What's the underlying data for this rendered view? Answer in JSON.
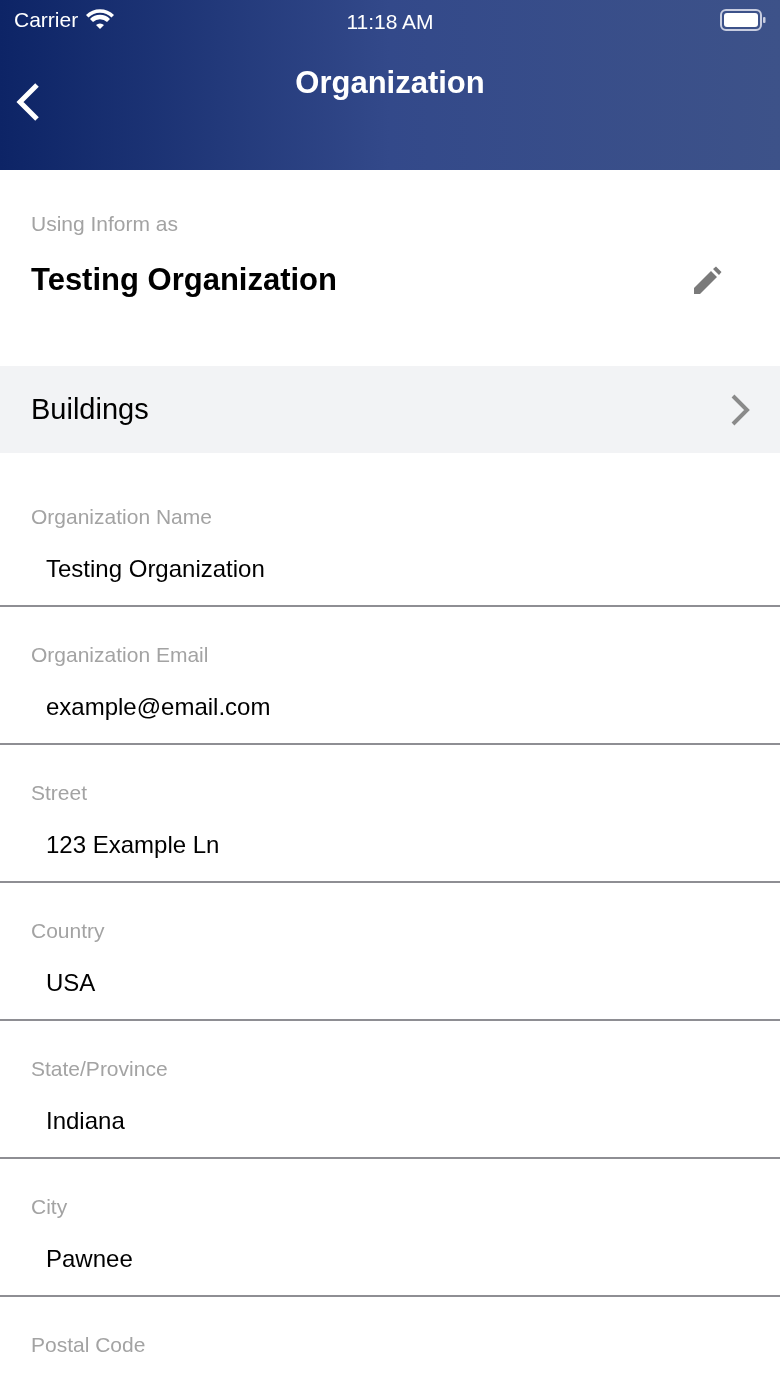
{
  "status_bar": {
    "carrier": "Carrier",
    "time": "11:18 AM"
  },
  "nav": {
    "title": "Organization"
  },
  "account": {
    "caption": "Using Inform as",
    "name": "Testing Organization"
  },
  "buildings": {
    "label": "Buildings"
  },
  "fields": [
    {
      "label": "Organization Name",
      "value": "Testing Organization"
    },
    {
      "label": "Organization Email",
      "value": "example@email.com"
    },
    {
      "label": "Street",
      "value": "123 Example Ln"
    },
    {
      "label": "Country",
      "value": "USA"
    },
    {
      "label": "State/Province",
      "value": "Indiana"
    },
    {
      "label": "City",
      "value": "Pawnee"
    },
    {
      "label": "Postal Code"
    }
  ]
}
